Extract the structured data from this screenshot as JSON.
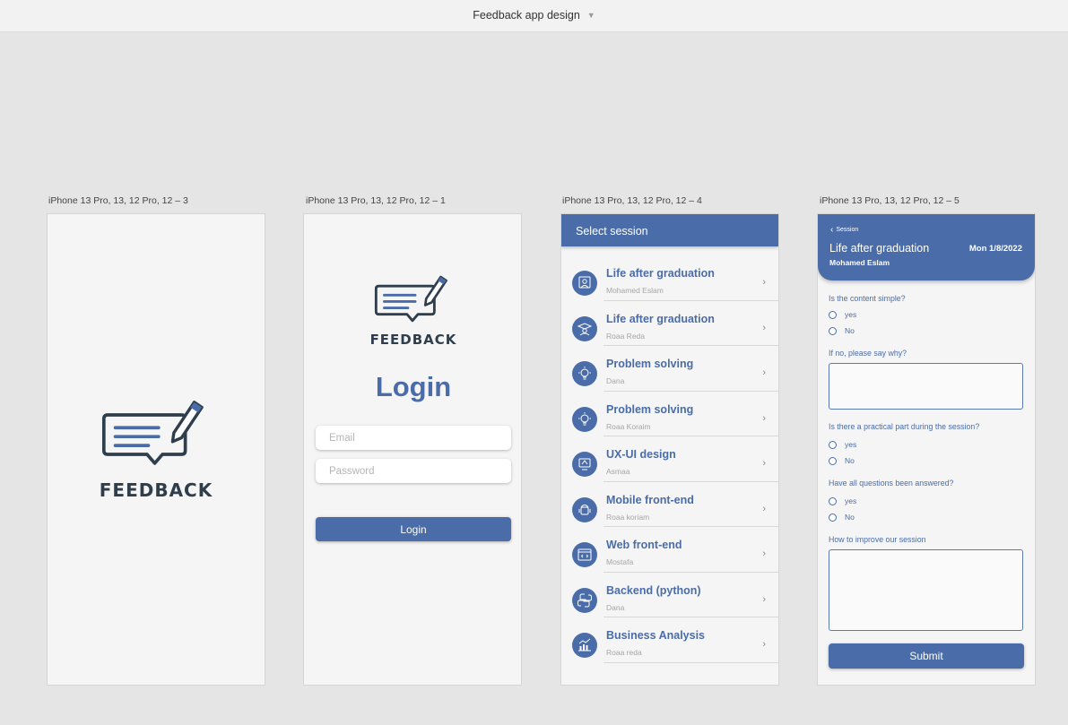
{
  "app": {
    "document_title": "Feedback app design"
  },
  "artboards": {
    "splash": {
      "label": "iPhone 13 Pro, 13, 12 Pro, 12 – 3",
      "logo_text": "FEEDBACK"
    },
    "login": {
      "label": "iPhone 13 Pro, 13, 12 Pro, 12 – 1",
      "logo_text": "FEEDBACK",
      "title": "Login",
      "email_placeholder": "Email",
      "password_placeholder": "Password",
      "login_button": "Login"
    },
    "sessions": {
      "label": "iPhone 13 Pro, 13, 12 Pro, 12 – 4",
      "header": "Select session",
      "items": [
        {
          "title": "Life after graduation",
          "speaker": "Mohamed Eslam",
          "icon": "graduate-icon"
        },
        {
          "title": "Life after graduation",
          "speaker": "Roaa Reda",
          "icon": "graduate-icon"
        },
        {
          "title": "Problem solving",
          "speaker": "Dana",
          "icon": "lightbulb-icon"
        },
        {
          "title": "Problem solving",
          "speaker": "Roaa Koraim",
          "icon": "lightbulb-icon"
        },
        {
          "title": "UX-UI design",
          "speaker": "Asmaa",
          "icon": "design-icon"
        },
        {
          "title": "Mobile front-end",
          "speaker": "Roaa koriam",
          "icon": "android-icon"
        },
        {
          "title": "Web front-end",
          "speaker": "Mostafa",
          "icon": "web-code-icon"
        },
        {
          "title": "Backend (python)",
          "speaker": "Dana",
          "icon": "python-icon"
        },
        {
          "title": "Business Analysis",
          "speaker": "Roaa reda",
          "icon": "chart-icon"
        }
      ]
    },
    "form": {
      "label": "iPhone 13 Pro, 13, 12 Pro, 12 – 5",
      "back_label": "Session",
      "session_title": "Life after graduation",
      "date": "Mon 1/8/2022",
      "author": "Mohamed Eslam",
      "q1": "Is the content simple?",
      "q1_yes": "yes",
      "q1_no": "No",
      "q1_followup": "If no, please say why?",
      "q2": "Is there a practical part during the session?",
      "q2_yes": "yes",
      "q2_no": "No",
      "q3": "Have all questions been answered?",
      "q3_yes": "yes",
      "q3_no": "No",
      "q4": "How to improve our session",
      "submit": "Submit"
    }
  },
  "colors": {
    "primary": "#4a6ca8",
    "logo_dark": "#2f3e4c",
    "canvas": "#e5e5e5"
  }
}
